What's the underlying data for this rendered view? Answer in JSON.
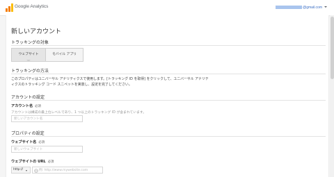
{
  "header": {
    "brand": "Google Analytics",
    "account_email_suffix": "@gmail.com"
  },
  "page": {
    "title": "新しいアカウント"
  },
  "tracking_target": {
    "heading": "トラッキングの対象",
    "tabs": [
      {
        "label": "ウェブサイト",
        "selected": true
      },
      {
        "label": "モバイル アプリ",
        "selected": false
      }
    ]
  },
  "tracking_method": {
    "heading": "トラッキングの方法",
    "description": "このプロパティはユニバーサル アナリティクスで使用します。[トラッキング ID を取得] をクリックして、ユニバーサル アナリティクスのトラッキング コード スニペットを実装し、設定を完了してください。"
  },
  "account_settings": {
    "heading": "アカウントの設定",
    "account_name_label": "アカウント名",
    "required": "必須",
    "account_name_help": "アカウントは構成の最上位レベルであり、1 つ以上のトラッキング ID が含まれています。",
    "account_name_placeholder": "新しいアカウント名",
    "account_name_value": ""
  },
  "property_settings": {
    "heading": "プロパティの設定",
    "website_name_label": "ウェブサイト名",
    "required": "必須",
    "website_name_placeholder": "新しいウェブサイト",
    "website_name_value": "",
    "website_url_label": "ウェブサイトの URL",
    "website_url_required": "必須",
    "protocol": "http://",
    "website_url_placeholder": "例: http://www.mywebsite.com",
    "website_url_value": ""
  },
  "colors": {
    "link": "#3b6ec4",
    "logo_orange": "#f57c00",
    "logo_yellow": "#fbbc04"
  },
  "icons": {
    "logo": "google-analytics-logo",
    "account_menu": "chevron-down-icon",
    "url_status": "globe-icon"
  }
}
